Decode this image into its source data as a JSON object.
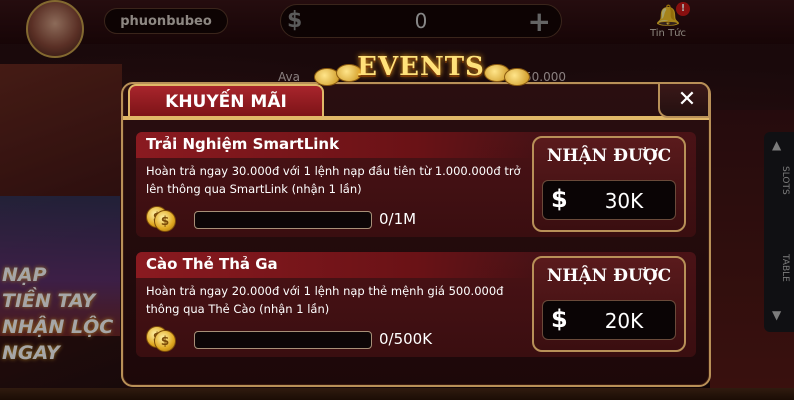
{
  "topbar": {
    "username": "phuonbubeo",
    "balance": "0",
    "currency_symbol": "$",
    "add_symbol": "+",
    "news_label": "Tin Tức",
    "news_badge": "!"
  },
  "background": {
    "left_promo_text": "NẠP\nTIỀN TAY\nNHẬN LỘC\nNGAY",
    "side_tab_top": "SLOTS",
    "side_tab_bottom": "TABLE",
    "ghost_left": "Ava",
    "ghost_right": "50.000"
  },
  "modal": {
    "banner_title": "EVENTS",
    "tab_label": "KHUYẾN MÃI",
    "close_symbol": "✕",
    "events": [
      {
        "title": "Trải Nghiệm SmartLink",
        "description": "Hoàn trả ngay 30.000đ với 1 lệnh nạp đầu tiên từ 1.000.000đ trở lên thông qua SmartLink (nhận 1 lần)",
        "progress_text": "0/1M",
        "progress": 0,
        "reward_label": "NHẬN ĐƯỢC",
        "reward_symbol": "$",
        "reward_amount": "30K"
      },
      {
        "title": "Cào Thẻ Thả Ga",
        "description": "Hoàn trả ngay 20.000đ với 1 lệnh nạp thẻ mệnh giá 500.000đ thông qua Thẻ Cào (nhận 1 lần)",
        "progress_text": "0/500K",
        "progress": 0,
        "reward_label": "NHẬN ĐƯỢC",
        "reward_symbol": "$",
        "reward_amount": "20K"
      }
    ]
  },
  "colors": {
    "accent_gold": "#e0b868",
    "tab_red": "#a8252c",
    "card_red": "#4a1216"
  }
}
